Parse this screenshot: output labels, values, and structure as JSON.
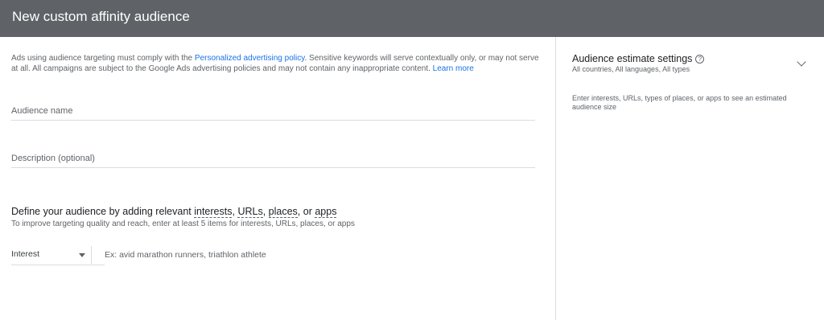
{
  "header": {
    "title": "New custom affinity audience"
  },
  "policy": {
    "text_before": "Ads using audience targeting must comply with the ",
    "link_policy": "Personalized advertising policy",
    "text_after": ". Sensitive keywords will serve contextually only, or may not serve at all. All campaigns are subject to the Google Ads advertising policies and may not contain any inappropriate content. ",
    "link_learn": "Learn more"
  },
  "form": {
    "audience_name_placeholder": "Audience name",
    "description_placeholder": "Description (optional)"
  },
  "define": {
    "title_prefix": "Define your audience by adding relevant ",
    "interests": "interests",
    "urls": "URLs",
    "places": "places",
    "apps": "apps",
    "sep1": ", ",
    "sep2": ", ",
    "sep3": ", or ",
    "subtitle": "To improve targeting quality and reach, enter at least 5 items for interests, URLs, places, or apps",
    "type_selected": "Interest",
    "item_placeholder": "Ex: avid marathon runners, triathlon athlete"
  },
  "estimate": {
    "title": "Audience estimate settings",
    "help_icon": "?",
    "subtitle": "All countries, All languages, All types",
    "note": "Enter interests, URLs, types of places, or apps to see an estimated audience size"
  }
}
